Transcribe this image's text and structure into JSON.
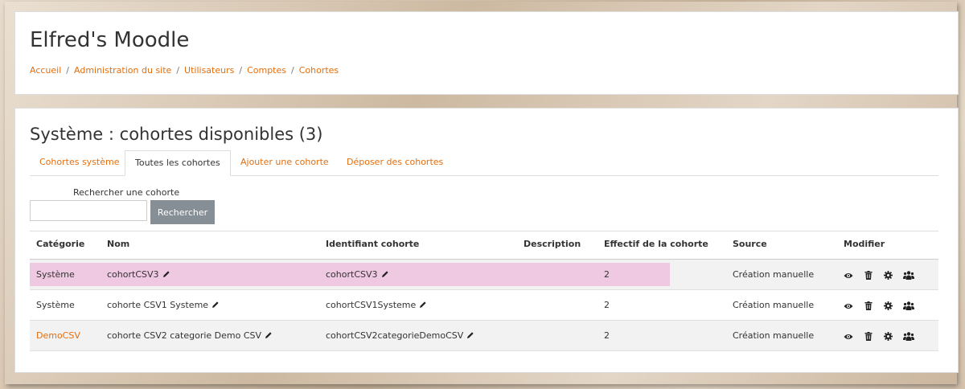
{
  "site": {
    "title": "Elfred's Moodle"
  },
  "breadcrumb": [
    "Accueil",
    "Administration du site",
    "Utilisateurs",
    "Comptes",
    "Cohortes"
  ],
  "page": {
    "heading": "Système : cohortes disponibles (3)"
  },
  "tabs": [
    {
      "label": "Cohortes système",
      "active": false
    },
    {
      "label": "Toutes les cohortes",
      "active": true
    },
    {
      "label": "Ajouter une cohorte",
      "active": false
    },
    {
      "label": "Déposer des cohortes",
      "active": false
    }
  ],
  "search": {
    "label": "Rechercher une cohorte",
    "value": "",
    "button_label": "Rechercher"
  },
  "table": {
    "headers": {
      "category": "Catégorie",
      "name": "Nom",
      "idnumber": "Identifiant cohorte",
      "description": "Description",
      "size": "Effectif de la cohorte",
      "source": "Source",
      "edit": "Modifier"
    },
    "rows": [
      {
        "category": "Système",
        "name": "cohortCSV3",
        "idnumber": "cohortCSV3",
        "description": "",
        "size": "2",
        "source": "Création manuelle",
        "category_link": false,
        "highlighted": true
      },
      {
        "category": "Système",
        "name": "cohorte CSV1 Systeme",
        "idnumber": "cohortCSV1Systeme",
        "description": "",
        "size": "2",
        "source": "Création manuelle",
        "category_link": false,
        "highlighted": false
      },
      {
        "category": "DemoCSV",
        "name": "cohorte CSV2 categorie Demo CSV",
        "idnumber": "cohortCSV2categorieDemoCSV",
        "description": "",
        "size": "2",
        "source": "Création manuelle",
        "category_link": true,
        "highlighted": false
      }
    ]
  },
  "icons": {
    "pencil": "pencil-icon",
    "view": "eye-icon",
    "delete": "trash-icon",
    "settings": "gear-icon",
    "members": "users-icon"
  },
  "colors": {
    "link": "#e46e0e",
    "highlight": "#efc9e2",
    "button": "#868e96"
  }
}
